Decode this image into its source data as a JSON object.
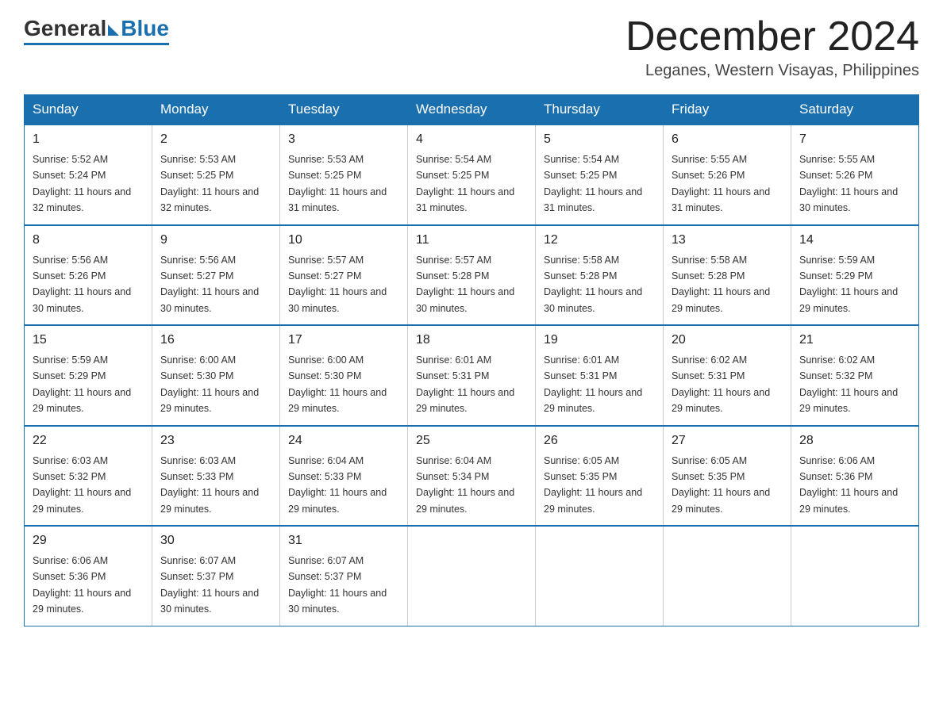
{
  "logo": {
    "general": "General",
    "blue": "Blue"
  },
  "title": "December 2024",
  "location": "Leganes, Western Visayas, Philippines",
  "days_of_week": [
    "Sunday",
    "Monday",
    "Tuesday",
    "Wednesday",
    "Thursday",
    "Friday",
    "Saturday"
  ],
  "weeks": [
    [
      {
        "day": "1",
        "sunrise": "5:52 AM",
        "sunset": "5:24 PM",
        "daylight": "11 hours and 32 minutes."
      },
      {
        "day": "2",
        "sunrise": "5:53 AM",
        "sunset": "5:25 PM",
        "daylight": "11 hours and 32 minutes."
      },
      {
        "day": "3",
        "sunrise": "5:53 AM",
        "sunset": "5:25 PM",
        "daylight": "11 hours and 31 minutes."
      },
      {
        "day": "4",
        "sunrise": "5:54 AM",
        "sunset": "5:25 PM",
        "daylight": "11 hours and 31 minutes."
      },
      {
        "day": "5",
        "sunrise": "5:54 AM",
        "sunset": "5:25 PM",
        "daylight": "11 hours and 31 minutes."
      },
      {
        "day": "6",
        "sunrise": "5:55 AM",
        "sunset": "5:26 PM",
        "daylight": "11 hours and 31 minutes."
      },
      {
        "day": "7",
        "sunrise": "5:55 AM",
        "sunset": "5:26 PM",
        "daylight": "11 hours and 30 minutes."
      }
    ],
    [
      {
        "day": "8",
        "sunrise": "5:56 AM",
        "sunset": "5:26 PM",
        "daylight": "11 hours and 30 minutes."
      },
      {
        "day": "9",
        "sunrise": "5:56 AM",
        "sunset": "5:27 PM",
        "daylight": "11 hours and 30 minutes."
      },
      {
        "day": "10",
        "sunrise": "5:57 AM",
        "sunset": "5:27 PM",
        "daylight": "11 hours and 30 minutes."
      },
      {
        "day": "11",
        "sunrise": "5:57 AM",
        "sunset": "5:28 PM",
        "daylight": "11 hours and 30 minutes."
      },
      {
        "day": "12",
        "sunrise": "5:58 AM",
        "sunset": "5:28 PM",
        "daylight": "11 hours and 30 minutes."
      },
      {
        "day": "13",
        "sunrise": "5:58 AM",
        "sunset": "5:28 PM",
        "daylight": "11 hours and 29 minutes."
      },
      {
        "day": "14",
        "sunrise": "5:59 AM",
        "sunset": "5:29 PM",
        "daylight": "11 hours and 29 minutes."
      }
    ],
    [
      {
        "day": "15",
        "sunrise": "5:59 AM",
        "sunset": "5:29 PM",
        "daylight": "11 hours and 29 minutes."
      },
      {
        "day": "16",
        "sunrise": "6:00 AM",
        "sunset": "5:30 PM",
        "daylight": "11 hours and 29 minutes."
      },
      {
        "day": "17",
        "sunrise": "6:00 AM",
        "sunset": "5:30 PM",
        "daylight": "11 hours and 29 minutes."
      },
      {
        "day": "18",
        "sunrise": "6:01 AM",
        "sunset": "5:31 PM",
        "daylight": "11 hours and 29 minutes."
      },
      {
        "day": "19",
        "sunrise": "6:01 AM",
        "sunset": "5:31 PM",
        "daylight": "11 hours and 29 minutes."
      },
      {
        "day": "20",
        "sunrise": "6:02 AM",
        "sunset": "5:31 PM",
        "daylight": "11 hours and 29 minutes."
      },
      {
        "day": "21",
        "sunrise": "6:02 AM",
        "sunset": "5:32 PM",
        "daylight": "11 hours and 29 minutes."
      }
    ],
    [
      {
        "day": "22",
        "sunrise": "6:03 AM",
        "sunset": "5:32 PM",
        "daylight": "11 hours and 29 minutes."
      },
      {
        "day": "23",
        "sunrise": "6:03 AM",
        "sunset": "5:33 PM",
        "daylight": "11 hours and 29 minutes."
      },
      {
        "day": "24",
        "sunrise": "6:04 AM",
        "sunset": "5:33 PM",
        "daylight": "11 hours and 29 minutes."
      },
      {
        "day": "25",
        "sunrise": "6:04 AM",
        "sunset": "5:34 PM",
        "daylight": "11 hours and 29 minutes."
      },
      {
        "day": "26",
        "sunrise": "6:05 AM",
        "sunset": "5:35 PM",
        "daylight": "11 hours and 29 minutes."
      },
      {
        "day": "27",
        "sunrise": "6:05 AM",
        "sunset": "5:35 PM",
        "daylight": "11 hours and 29 minutes."
      },
      {
        "day": "28",
        "sunrise": "6:06 AM",
        "sunset": "5:36 PM",
        "daylight": "11 hours and 29 minutes."
      }
    ],
    [
      {
        "day": "29",
        "sunrise": "6:06 AM",
        "sunset": "5:36 PM",
        "daylight": "11 hours and 29 minutes."
      },
      {
        "day": "30",
        "sunrise": "6:07 AM",
        "sunset": "5:37 PM",
        "daylight": "11 hours and 30 minutes."
      },
      {
        "day": "31",
        "sunrise": "6:07 AM",
        "sunset": "5:37 PM",
        "daylight": "11 hours and 30 minutes."
      },
      null,
      null,
      null,
      null
    ]
  ]
}
